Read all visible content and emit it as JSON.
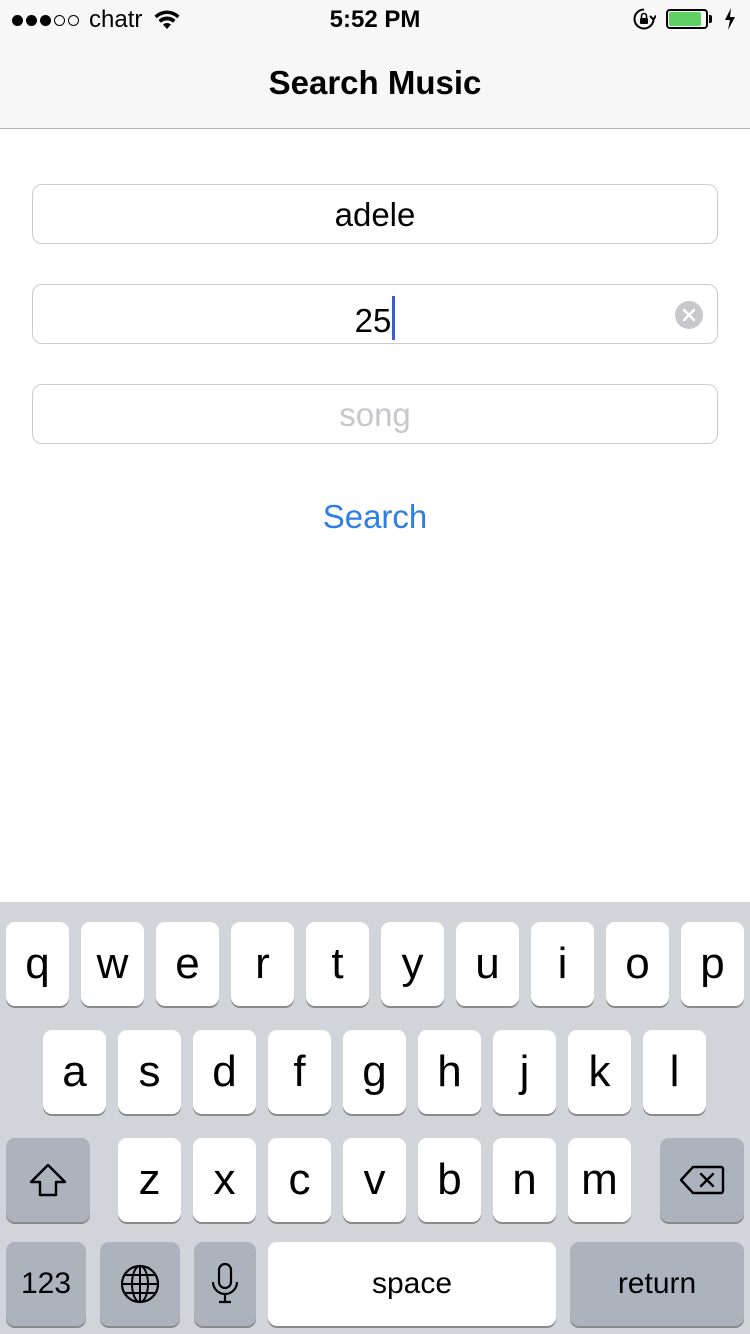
{
  "status_bar": {
    "signal_dots": [
      true,
      true,
      true,
      false,
      false
    ],
    "carrier": "chatr",
    "time": "5:52 PM",
    "battery_level": 0.9,
    "icons": [
      "wifi-icon",
      "rotation-lock-icon",
      "battery-icon",
      "charging-bolt-icon"
    ]
  },
  "nav": {
    "title": "Search Music"
  },
  "form": {
    "artist_value": "adele",
    "album_value": "25",
    "song_placeholder": "song",
    "search_label": "Search"
  },
  "keyboard": {
    "row1": [
      "q",
      "w",
      "e",
      "r",
      "t",
      "y",
      "u",
      "i",
      "o",
      "p"
    ],
    "row2": [
      "a",
      "s",
      "d",
      "f",
      "g",
      "h",
      "j",
      "k",
      "l"
    ],
    "row3": [
      "z",
      "x",
      "c",
      "v",
      "b",
      "n",
      "m"
    ],
    "numbers_label": "123",
    "space_label": "space",
    "return_label": "return",
    "icons": [
      "shift-icon",
      "backspace-icon",
      "globe-icon",
      "microphone-icon"
    ]
  },
  "colors": {
    "accent": "#2f7ee6",
    "caret": "#3c5bd9",
    "battery": "#5fd063",
    "placeholder": "#c7c7cd"
  }
}
